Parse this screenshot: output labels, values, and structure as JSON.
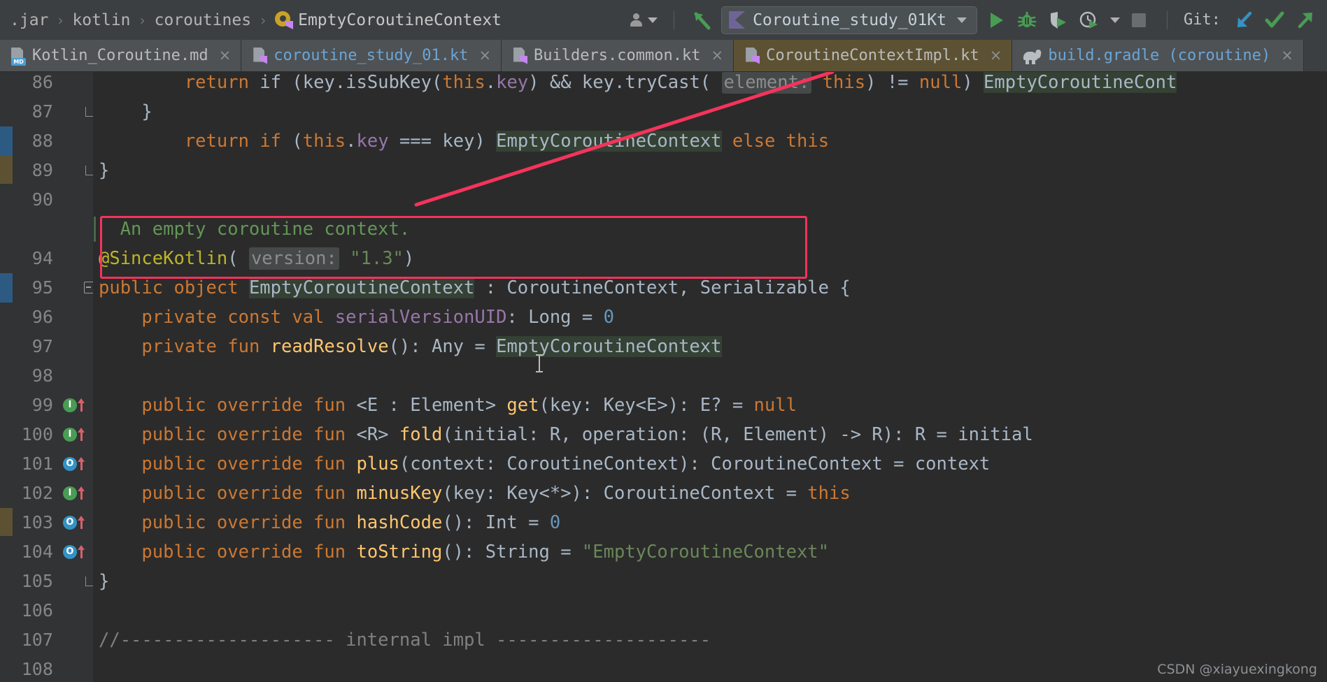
{
  "window": {
    "theme_background": "#2b2b2b",
    "chrome_background": "#3c3f41"
  },
  "breadcrumb": {
    "items": [
      ".jar",
      "kotlin",
      "coroutines",
      "EmptyCoroutineContext"
    ],
    "separator": "›",
    "object_icon": "kotlin-object-icon"
  },
  "toolbar": {
    "person_icon": "person-icon",
    "person_caret": "chevron-down-icon",
    "vcs_update_icon": "vcs-arrow-icon",
    "run_config": {
      "icon": "kotlin-run-icon",
      "label": "Coroutine_study_01Kt",
      "caret": "chevron-down-icon"
    },
    "run_icon": "run-icon",
    "debug_icon": "debug-icon",
    "coverage_icon": "run-with-coverage-icon",
    "profile_icon": "profiler-icon",
    "profile_caret": "chevron-down-icon",
    "stop_icon": "stop-icon",
    "git_label": "Git:",
    "git_update_icon": "git-update-icon",
    "git_commit_icon": "git-commit-icon",
    "git_push_icon": "git-push-icon"
  },
  "tabs": [
    {
      "label": "Kotlin_Coroutine.md",
      "icon": "markdown-file-icon",
      "active": false,
      "color": "grey",
      "close": "×"
    },
    {
      "label": "coroutine_study_01.kt",
      "icon": "kotlin-file-icon",
      "active": false,
      "color": "blue",
      "close": "×"
    },
    {
      "label": "Builders.common.kt",
      "icon": "kotlin-file-icon",
      "active": false,
      "color": "grey",
      "close": "×"
    },
    {
      "label": "CoroutineContextImpl.kt",
      "icon": "kotlin-file-icon",
      "active": true,
      "color": "grey",
      "close": "×"
    },
    {
      "label": "build.gradle (coroutine)",
      "icon": "gradle-file-icon",
      "active": false,
      "color": "blue",
      "close": "×"
    }
  ],
  "editor": {
    "first_visible_line": 86,
    "lines": [
      {
        "no": "86",
        "gutter": "none",
        "clipped": true,
        "tokens": [
          {
            "t": "        ",
            "c": ""
          },
          {
            "t": "return",
            "c": "kw"
          },
          {
            "t": " if (key.",
            "c": ""
          },
          {
            "t": "isSubKey",
            "c": ""
          },
          {
            "t": "(",
            "c": ""
          },
          {
            "t": "this",
            "c": "kw"
          },
          {
            "t": ".",
            "c": ""
          },
          {
            "t": "key",
            "c": "prop"
          },
          {
            "t": ") && key.",
            "c": ""
          },
          {
            "t": "tryCast",
            "c": ""
          },
          {
            "t": "( ",
            "c": ""
          },
          {
            "t": "element:",
            "c": "inlay"
          },
          {
            "t": " ",
            "c": ""
          },
          {
            "t": "this",
            "c": "kw"
          },
          {
            "t": ") != ",
            "c": ""
          },
          {
            "t": "null",
            "c": "kw"
          },
          {
            "t": ") ",
            "c": ""
          },
          {
            "t": "EmptyCoroutineCont",
            "c": "hl-usage"
          }
        ]
      },
      {
        "no": "87",
        "gutter": "fold-end",
        "tokens": [
          {
            "t": "    }",
            "c": ""
          }
        ]
      },
      {
        "no": "88",
        "gutter": "none",
        "tokens": [
          {
            "t": "        ",
            "c": ""
          },
          {
            "t": "return",
            "c": "kw"
          },
          {
            "t": " ",
            "c": ""
          },
          {
            "t": "if",
            "c": "kw"
          },
          {
            "t": " (",
            "c": ""
          },
          {
            "t": "this",
            "c": "kw"
          },
          {
            "t": ".",
            "c": ""
          },
          {
            "t": "key",
            "c": "prop"
          },
          {
            "t": " === key) ",
            "c": ""
          },
          {
            "t": "EmptyCoroutineContext",
            "c": "hl-usage"
          },
          {
            "t": " ",
            "c": ""
          },
          {
            "t": "else",
            "c": "kw"
          },
          {
            "t": " ",
            "c": ""
          },
          {
            "t": "this",
            "c": "kw"
          }
        ]
      },
      {
        "no": "89",
        "gutter": "fold-end",
        "tokens": [
          {
            "t": "}",
            "c": ""
          }
        ]
      },
      {
        "no": "90",
        "gutter": "none",
        "tokens": []
      },
      {
        "no": "",
        "gutter": "none",
        "doc": true,
        "tokens": [
          {
            "t": "  An empty coroutine context.",
            "c": "cmt"
          }
        ]
      },
      {
        "no": "94",
        "gutter": "none",
        "tokens": [
          {
            "t": "@SinceKotlin",
            "c": "anno"
          },
          {
            "t": "( ",
            "c": ""
          },
          {
            "t": "version:",
            "c": "inlay"
          },
          {
            "t": " ",
            "c": ""
          },
          {
            "t": "\"1.3\"",
            "c": "str"
          },
          {
            "t": ")",
            "c": ""
          }
        ]
      },
      {
        "no": "95",
        "gutter": "fold-start",
        "tokens": [
          {
            "t": "public object",
            "c": "kw"
          },
          {
            "t": " ",
            "c": ""
          },
          {
            "t": "EmptyCoroutineContext",
            "c": "hl-usage"
          },
          {
            "t": " : CoroutineContext, Serializable {",
            "c": ""
          }
        ]
      },
      {
        "no": "96",
        "gutter": "none",
        "tokens": [
          {
            "t": "    ",
            "c": ""
          },
          {
            "t": "private const val",
            "c": "kw"
          },
          {
            "t": " ",
            "c": ""
          },
          {
            "t": "serialVersionUID",
            "c": "prop"
          },
          {
            "t": ": Long = ",
            "c": ""
          },
          {
            "t": "0",
            "c": "num"
          }
        ]
      },
      {
        "no": "97",
        "gutter": "none",
        "tokens": [
          {
            "t": "    ",
            "c": ""
          },
          {
            "t": "private fun",
            "c": "kw"
          },
          {
            "t": " ",
            "c": ""
          },
          {
            "t": "readResolve",
            "c": "fn"
          },
          {
            "t": "(): Any = ",
            "c": ""
          },
          {
            "t": "EmptyCoroutineContext",
            "c": "hl-usage"
          }
        ]
      },
      {
        "no": "98",
        "gutter": "none",
        "tokens": []
      },
      {
        "no": "99",
        "gutter": "implement",
        "tokens": [
          {
            "t": "    ",
            "c": ""
          },
          {
            "t": "public override fun",
            "c": "kw"
          },
          {
            "t": " <E : Element> ",
            "c": ""
          },
          {
            "t": "get",
            "c": "fn"
          },
          {
            "t": "(key: Key<E>): E? = ",
            "c": ""
          },
          {
            "t": "null",
            "c": "kw"
          }
        ]
      },
      {
        "no": "100",
        "gutter": "implement",
        "tokens": [
          {
            "t": "    ",
            "c": ""
          },
          {
            "t": "public override fun",
            "c": "kw"
          },
          {
            "t": " <R> ",
            "c": ""
          },
          {
            "t": "fold",
            "c": "fn"
          },
          {
            "t": "(",
            "c": ""
          },
          {
            "t": "initial:",
            "c": ""
          },
          {
            "t": " R, operation: (R, Element) -> R): R = initial",
            "c": ""
          }
        ]
      },
      {
        "no": "101",
        "gutter": "override",
        "tokens": [
          {
            "t": "    ",
            "c": ""
          },
          {
            "t": "public override fun",
            "c": "kw"
          },
          {
            "t": " ",
            "c": ""
          },
          {
            "t": "plus",
            "c": "fn"
          },
          {
            "t": "(context: CoroutineContext): CoroutineContext = context",
            "c": ""
          }
        ]
      },
      {
        "no": "102",
        "gutter": "implement",
        "tokens": [
          {
            "t": "    ",
            "c": ""
          },
          {
            "t": "public override fun",
            "c": "kw"
          },
          {
            "t": " ",
            "c": ""
          },
          {
            "t": "minusKey",
            "c": "fn"
          },
          {
            "t": "(key: Key<*>): CoroutineContext = ",
            "c": ""
          },
          {
            "t": "this",
            "c": "kw"
          }
        ]
      },
      {
        "no": "103",
        "gutter": "override",
        "tokens": [
          {
            "t": "    ",
            "c": ""
          },
          {
            "t": "public override fun",
            "c": "kw"
          },
          {
            "t": " ",
            "c": ""
          },
          {
            "t": "hashCode",
            "c": "fn"
          },
          {
            "t": "(): Int = ",
            "c": ""
          },
          {
            "t": "0",
            "c": "num"
          }
        ]
      },
      {
        "no": "104",
        "gutter": "override",
        "tokens": [
          {
            "t": "    ",
            "c": ""
          },
          {
            "t": "public override fun",
            "c": "kw"
          },
          {
            "t": " ",
            "c": ""
          },
          {
            "t": "toString",
            "c": "fn"
          },
          {
            "t": "(): String = ",
            "c": ""
          },
          {
            "t": "\"EmptyCoroutineContext\"",
            "c": "str"
          }
        ]
      },
      {
        "no": "105",
        "gutter": "fold-end",
        "tokens": [
          {
            "t": "}",
            "c": ""
          }
        ]
      },
      {
        "no": "106",
        "gutter": "none",
        "tokens": []
      },
      {
        "no": "107",
        "gutter": "none",
        "tokens": [
          {
            "t": "//-------------------- internal impl --------------------",
            "c": "cmtline"
          }
        ]
      },
      {
        "no": "108",
        "gutter": "none",
        "tokens": []
      }
    ]
  },
  "annotations": {
    "highlight_box_color": "#f5335b",
    "pointer_line_color": "#f5335b"
  },
  "watermark": {
    "text": "CSDN @xiayuexingkong"
  },
  "colors": {
    "keyword": "#cc7832",
    "string": "#6a8759",
    "number": "#6897bb",
    "function": "#ffc66d",
    "property": "#9876aa",
    "annotation": "#bbb529",
    "doc_comment": "#629755",
    "line_comment": "#808080",
    "default_text": "#a9b7c6",
    "usage_highlight": "#344134",
    "active_tab": "#5c5233",
    "accent_run": "#499c54"
  }
}
